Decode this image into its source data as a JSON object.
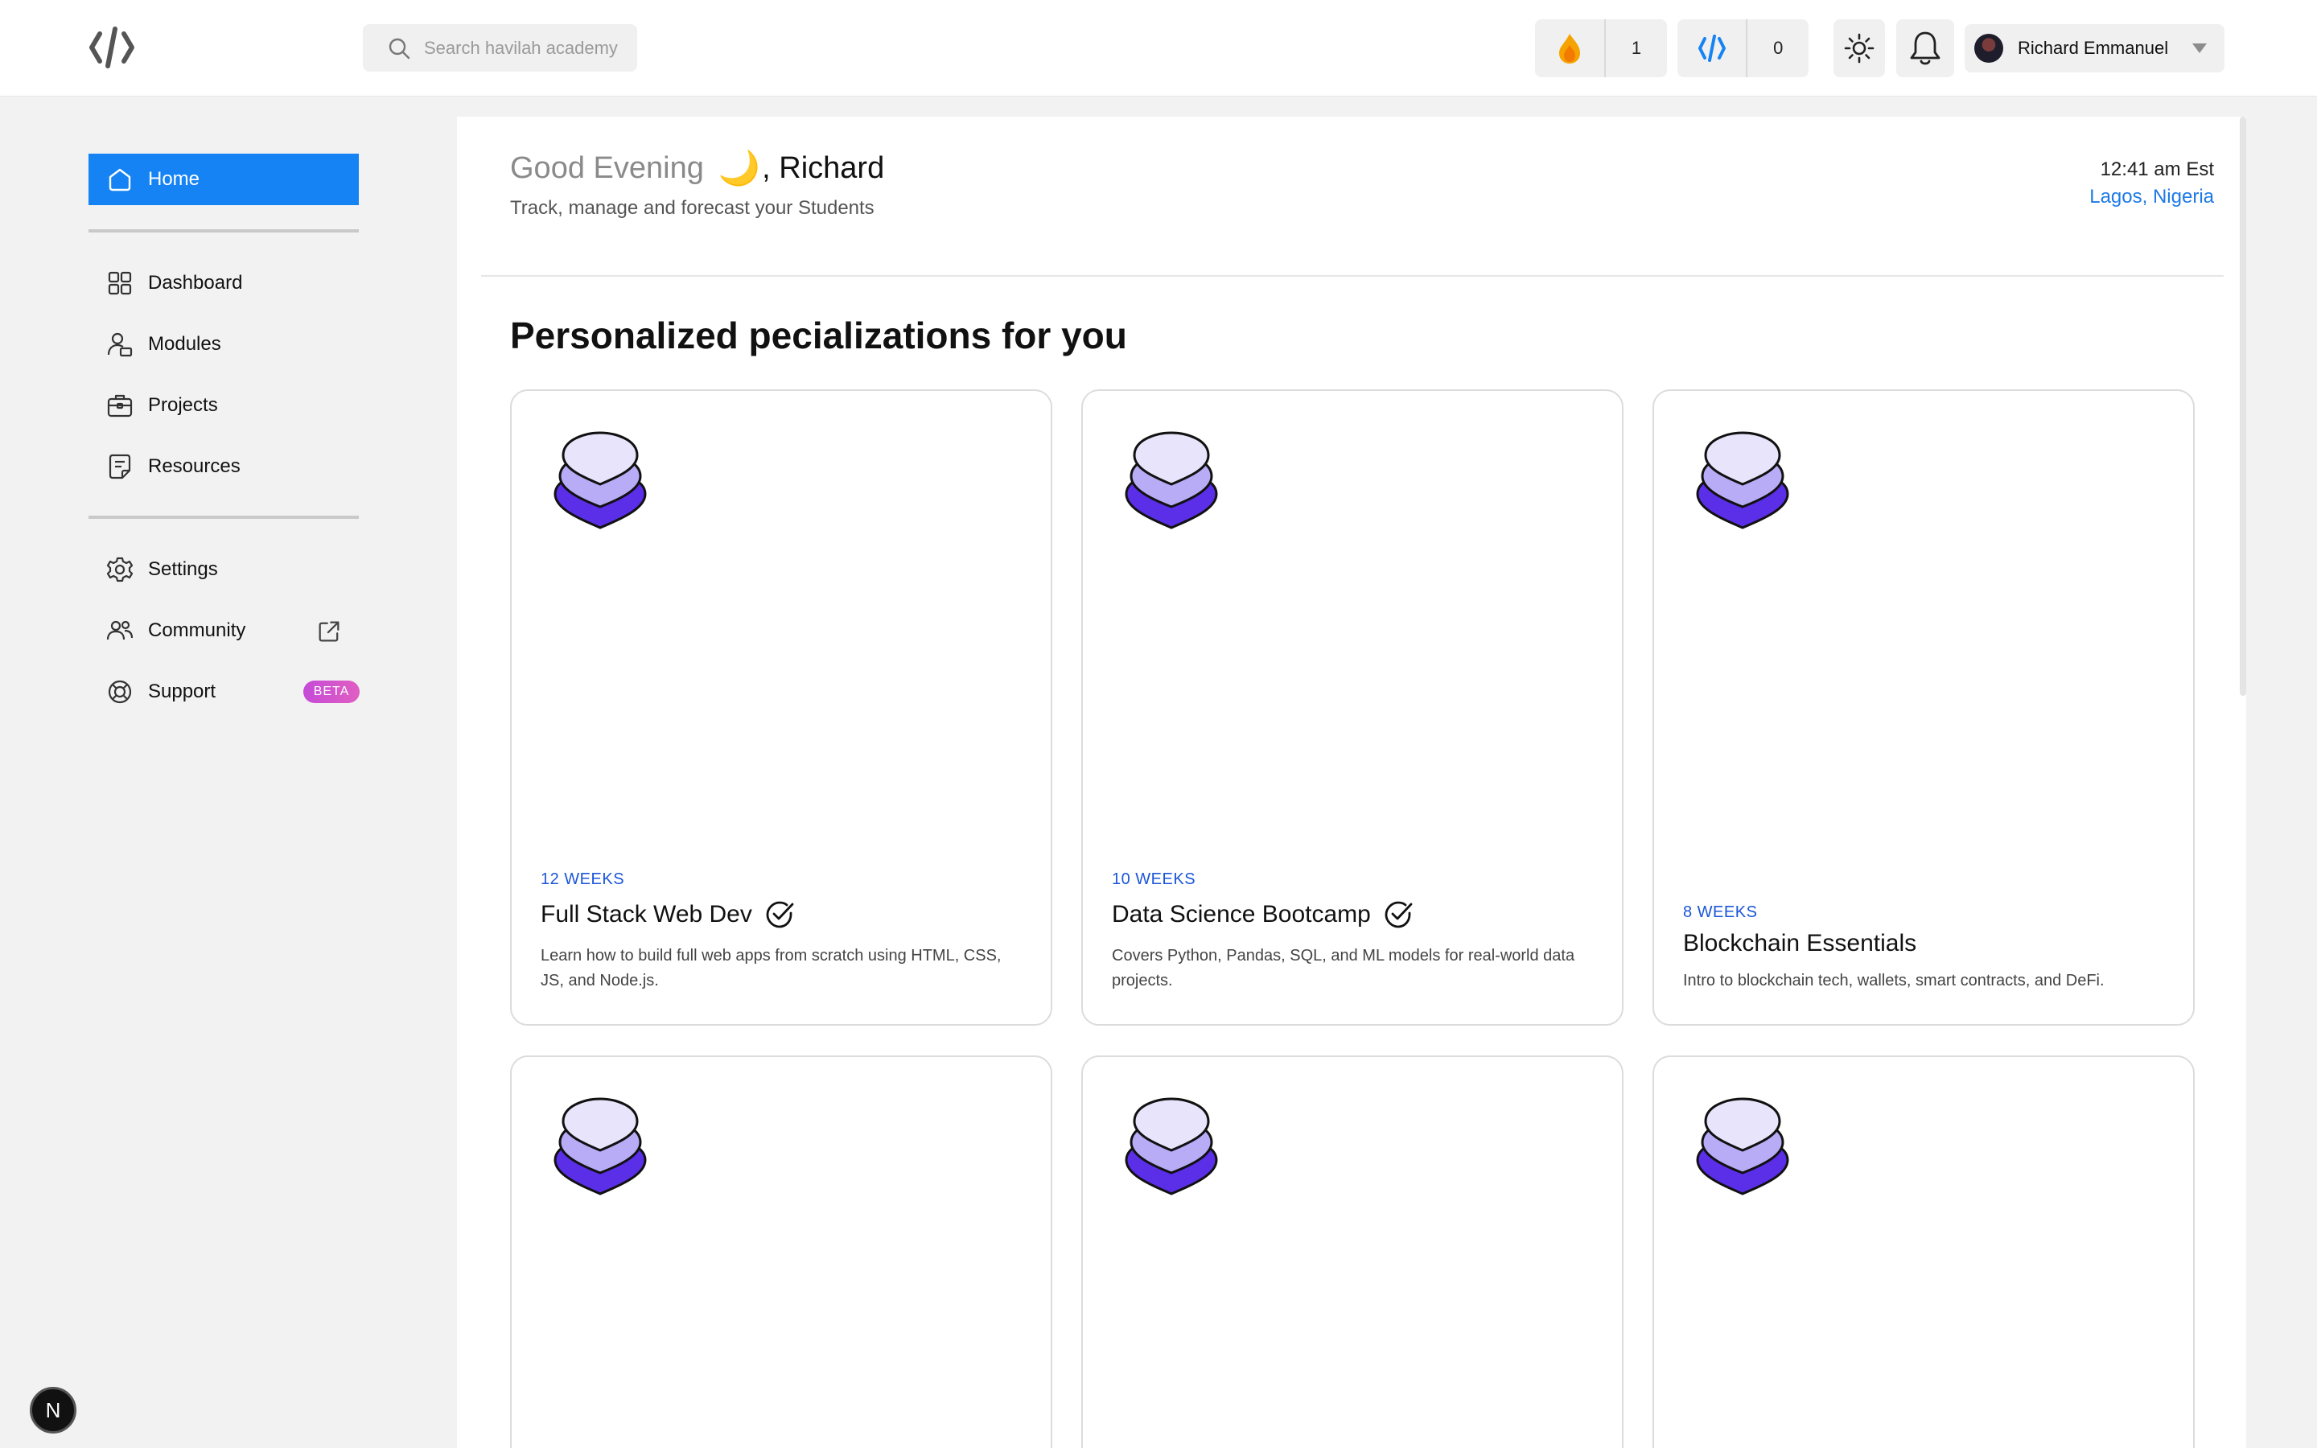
{
  "header": {
    "search_placeholder": "Search havilah academy",
    "streak_count": "1",
    "code_count": "0",
    "user_name": "Richard Emmanuel"
  },
  "sidebar": {
    "items": [
      {
        "label": "Home",
        "icon": "home-icon",
        "active": true
      },
      {
        "label": "Dashboard",
        "icon": "grid-icon"
      },
      {
        "label": "Modules",
        "icon": "user-book-icon"
      },
      {
        "label": "Projects",
        "icon": "briefcase-icon"
      },
      {
        "label": "Resources",
        "icon": "note-icon"
      },
      {
        "label": "Settings",
        "icon": "gear-icon"
      },
      {
        "label": "Community",
        "icon": "users-icon"
      },
      {
        "label": "Support",
        "icon": "lifebuoy-icon"
      }
    ],
    "beta_label": "BETA",
    "badge_label": "N"
  },
  "main": {
    "greeting": "Good Evening",
    "name": ", Richard",
    "subtitle": "Track, manage and forecast your Students",
    "time": "12:41 am Est",
    "location": "Lagos, Nigeria",
    "section_title": "Personalized pecializations for you",
    "cards": [
      {
        "duration": "12 WEEKS",
        "title": "Full Stack Web Dev",
        "checked": true,
        "description": "Learn how to build full web apps from scratch using HTML, CSS, JS, and Node.js."
      },
      {
        "duration": "10 WEEKS",
        "title": "Data Science Bootcamp",
        "checked": true,
        "description": "Covers Python, Pandas, SQL, and ML models for real-world data projects."
      },
      {
        "duration": "8 WEEKS",
        "title": "Blockchain Essentials",
        "checked": false,
        "description": "Intro to blockchain tech, wallets, smart contracts, and DeFi."
      }
    ]
  },
  "colors": {
    "accent": "#1683f4",
    "duration_blue": "#1b56d9",
    "beta_gradient_start": "#c54bd8",
    "stack_dark": "#5b2ee8",
    "stack_mid": "#b7acf5",
    "stack_light": "#e8e4fb"
  }
}
